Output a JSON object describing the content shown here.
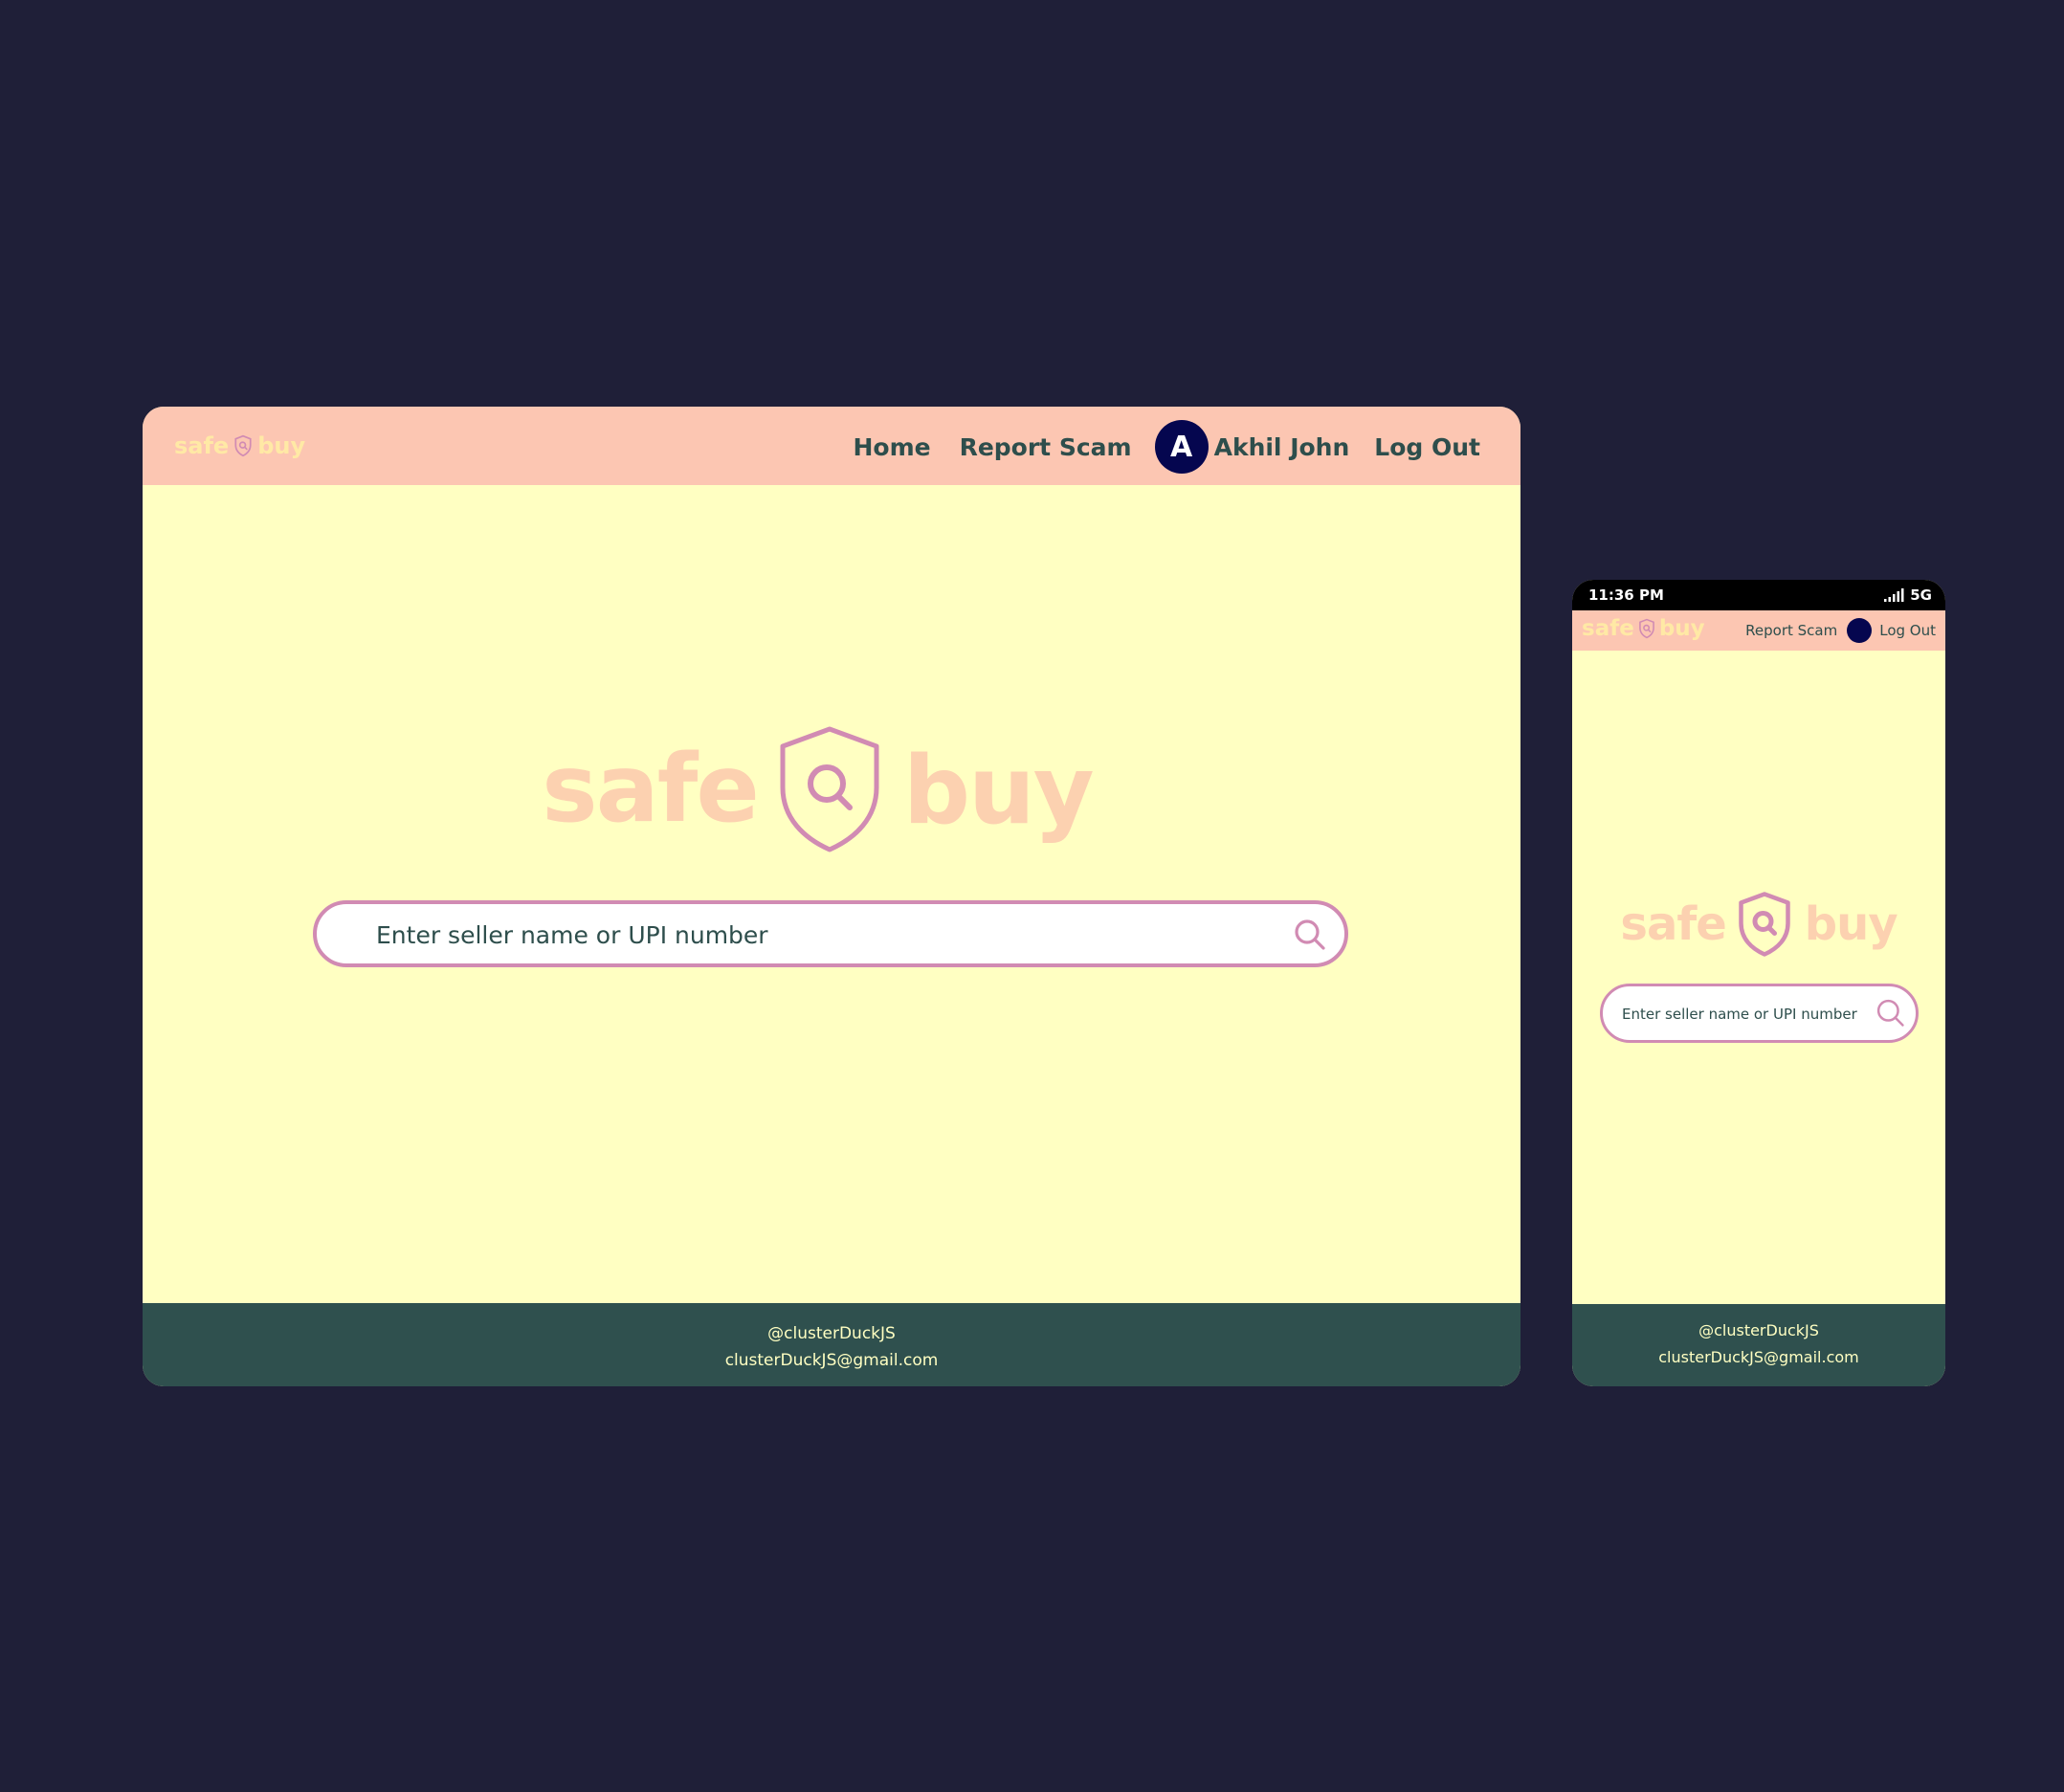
{
  "brand": {
    "word1": "safe",
    "word2": "buy",
    "colors": {
      "background": "#1f1f38",
      "nav": "#fcc6b2",
      "body": "#ffffc2",
      "footer": "#2f504e",
      "accent": "#d18bb3",
      "brand_text_small": "#ffe9a5",
      "brand_text_large": "#fcd1b0",
      "avatar": "#05064f",
      "text": "#2e4e4c"
    },
    "logo_icon": "shield-search-icon"
  },
  "desktop": {
    "nav": {
      "home": "Home",
      "report": "Report Scam",
      "avatar_initial": "A",
      "user_name": "Akhil John",
      "logout": "Log Out"
    },
    "search": {
      "placeholder": "Enter seller name or UPI number",
      "icon": "search-icon"
    },
    "footer": {
      "handle": "@clusterDuckJS",
      "email": "clusterDuckJS@gmail.com"
    }
  },
  "mobile": {
    "status": {
      "time": "11:36 PM",
      "network": "5G",
      "signal_icon": "signal-icon"
    },
    "nav": {
      "report": "Report Scam",
      "logout": "Log Out"
    },
    "search": {
      "placeholder": "Enter seller name or UPI number",
      "icon": "search-icon"
    },
    "footer": {
      "handle": "@clusterDuckJS",
      "email": "clusterDuckJS@gmail.com"
    }
  }
}
